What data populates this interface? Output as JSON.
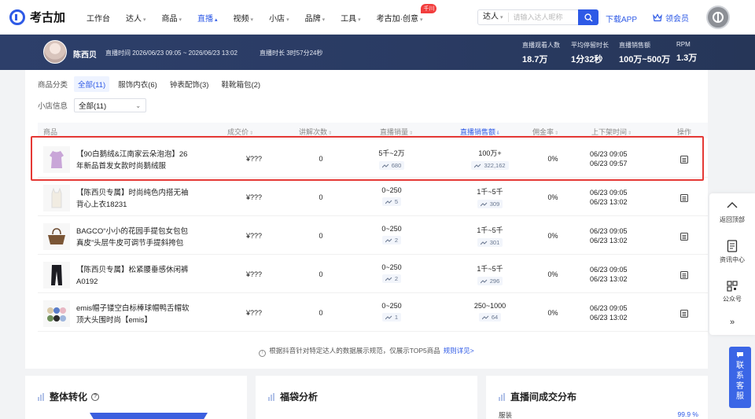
{
  "brand": {
    "name": "考古加"
  },
  "nav": {
    "items": [
      {
        "label": "工作台",
        "has_caret": false
      },
      {
        "label": "达人",
        "has_caret": true
      },
      {
        "label": "商品",
        "has_caret": true
      },
      {
        "label": "直播",
        "has_caret": true,
        "active": true
      },
      {
        "label": "视频",
        "has_caret": true
      },
      {
        "label": "小店",
        "has_caret": true
      },
      {
        "label": "品牌",
        "has_caret": true
      },
      {
        "label": "工具",
        "has_caret": true
      },
      {
        "label": "考古加·创意",
        "has_caret": true,
        "badge": "千川"
      }
    ],
    "search_type": "达人",
    "search_placeholder": "请输入达人昵称",
    "download_label": "下载APP",
    "vip_label": "领会员"
  },
  "live_header": {
    "streamer_name": "陈西贝",
    "live_time": "直播时间   2026/06/23 09:05 ~ 2026/06/23 13:02",
    "live_duration": "直播时长   3时57分24秒",
    "stats": [
      {
        "label": "直播观看人数",
        "value": "18.7万"
      },
      {
        "label": "平均停留时长",
        "value": "1分32秒"
      },
      {
        "label": "直播销售额",
        "value": "100万~500万"
      },
      {
        "label": "RPM",
        "value": "1.3万"
      }
    ]
  },
  "filters": {
    "category_label": "商品分类",
    "category_chips": [
      "全部(11)",
      "服饰内衣(6)",
      "钟表配饰(3)",
      "鞋靴箱包(2)"
    ],
    "active_chip": 0,
    "shop_label": "小店信息",
    "shop_select": "全部(11)"
  },
  "table": {
    "columns": [
      "商品",
      "成交价",
      "讲解次数",
      "直播销量",
      "直播销售额",
      "佣金率",
      "上下架时间",
      "操作"
    ],
    "sorted_column": "直播销售额",
    "rows": [
      {
        "name": "【90白鹅绒&江南家云朵泡泡】26年新品首发女款时尚鹅绒服",
        "price": "¥???",
        "explain": "0",
        "sales": "5千~2万",
        "sales_trend": "680",
        "revenue": "100万+",
        "revenue_trend": "322,162",
        "commission": "0%",
        "on_time": "06/23 09:05",
        "off_time": "06/23 09:57",
        "thumb": "purple-coat"
      },
      {
        "name": "【陈西贝专属】时尚纯色内搭无袖背心上衣18231",
        "price": "¥???",
        "explain": "0",
        "sales": "0~250",
        "sales_trend": "5",
        "revenue": "1千~5千",
        "revenue_trend": "309",
        "commission": "0%",
        "on_time": "06/23 09:05",
        "off_time": "06/23 13:02",
        "thumb": "white-vest"
      },
      {
        "name": "BAGCO“小小的花园手提包女包包真皮”头层牛皮可调节手提斜挎包",
        "price": "¥???",
        "explain": "0",
        "sales": "0~250",
        "sales_trend": "2",
        "revenue": "1千~5千",
        "revenue_trend": "301",
        "commission": "0%",
        "on_time": "06/23 09:05",
        "off_time": "06/23 13:02",
        "thumb": "brown-bag"
      },
      {
        "name": "【陈西贝专属】松紧腰垂感休闲裤A0192",
        "price": "¥???",
        "explain": "0",
        "sales": "0~250",
        "sales_trend": "2",
        "revenue": "1千~5千",
        "revenue_trend": "296",
        "commission": "0%",
        "on_time": "06/23 09:05",
        "off_time": "06/23 13:02",
        "thumb": "black-pants"
      },
      {
        "name": "emis帽子镂空白标棒球帽鸭舌帽软顶大头围时尚【emis】",
        "price": "¥???",
        "explain": "0",
        "sales": "0~250",
        "sales_trend": "1",
        "revenue": "250~1000",
        "revenue_trend": "64",
        "commission": "0%",
        "on_time": "06/23 09:05",
        "off_time": "06/23 13:02",
        "thumb": "caps"
      }
    ],
    "notice": "根据抖音针对特定达人的数据展示规范，仅展示TOP5商品",
    "notice_link": "规则详见>"
  },
  "bottom_cards": [
    {
      "title": "整体转化",
      "has_help": true
    },
    {
      "title": "福袋分析",
      "has_help": false
    },
    {
      "title": "直播间成交分布",
      "has_help": false,
      "first_item": {
        "label": "服装",
        "pct": "99.9 %"
      }
    }
  ],
  "side_panel": {
    "items": [
      "返回顶部",
      "资讯中心",
      "公众号"
    ],
    "collapse": "»"
  },
  "service_label": "联系客服",
  "colors": {
    "accent": "#2e5ae6",
    "header_bg": "#2a3b63",
    "highlight": "#e53935"
  }
}
